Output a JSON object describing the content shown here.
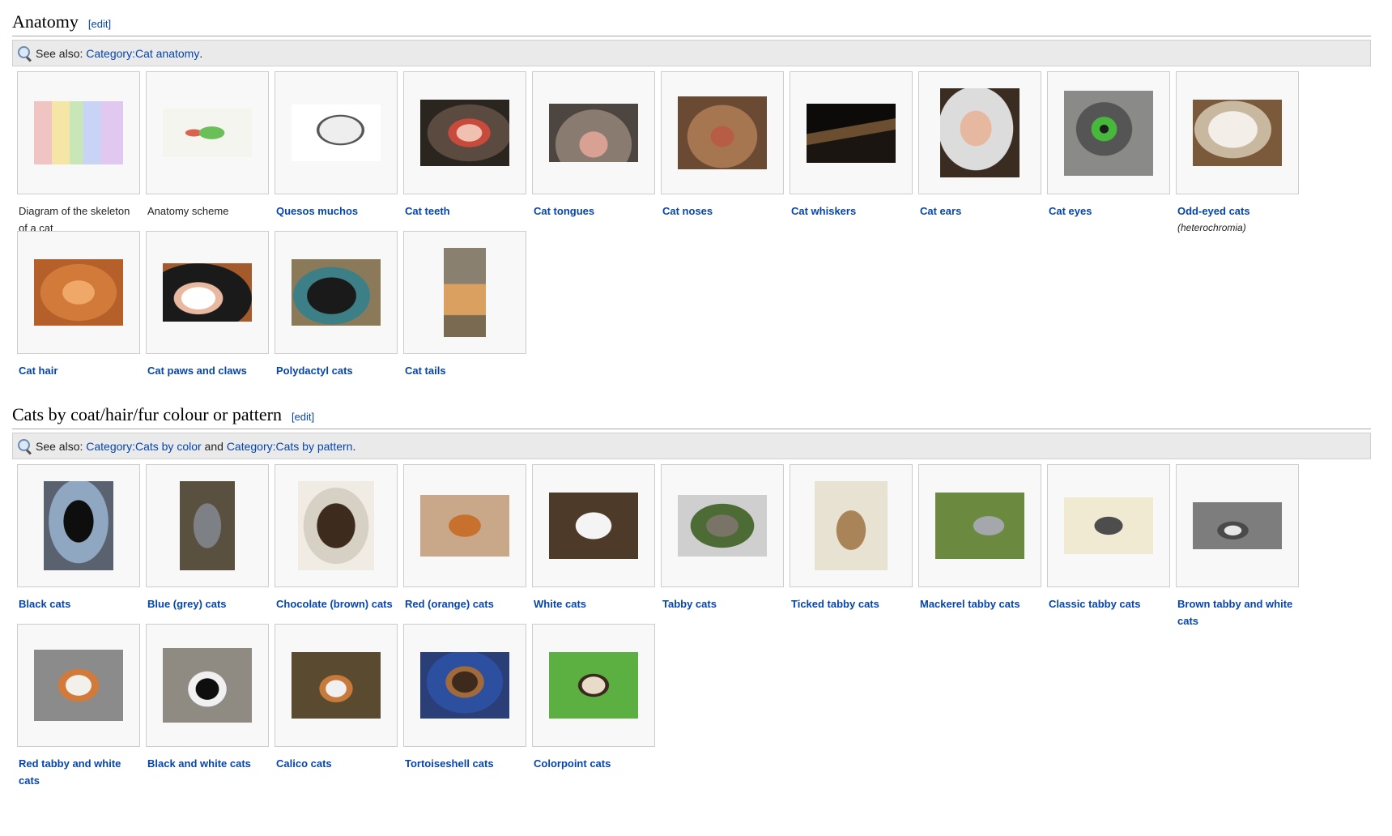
{
  "sections": [
    {
      "title": "Anatomy",
      "edit_label": "[edit]",
      "seealso_prefix": "See also: ",
      "seealso_links": [
        "Category:Cat anatomy"
      ],
      "seealso_suffix": ".",
      "items": [
        {
          "caption": "Diagram of the skeleton of a cat",
          "link": false,
          "icon": "skeleton-diagram-image"
        },
        {
          "caption": "Anatomy scheme",
          "link": false,
          "icon": "anatomy-scheme-image"
        },
        {
          "caption": "Quesos muchos",
          "link": true,
          "icon": "cat-skull-image"
        },
        {
          "caption": "Cat teeth",
          "link": true,
          "icon": "cat-teeth-image"
        },
        {
          "caption": "Cat tongues",
          "link": true,
          "icon": "cat-tongue-image"
        },
        {
          "caption": "Cat noses",
          "link": true,
          "icon": "cat-nose-image"
        },
        {
          "caption": "Cat whiskers",
          "link": true,
          "icon": "cat-whiskers-image"
        },
        {
          "caption": "Cat ears",
          "link": true,
          "icon": "cat-ear-image"
        },
        {
          "caption": "Cat eyes",
          "link": true,
          "icon": "cat-eye-image"
        },
        {
          "caption": "Odd-eyed cats",
          "sub": "(heterochromia)",
          "link": true,
          "icon": "odd-eyed-cat-image"
        },
        {
          "caption": "Cat hair",
          "link": true,
          "icon": "cat-hair-image"
        },
        {
          "caption": "Cat paws and claws",
          "link": true,
          "icon": "cat-paw-image"
        },
        {
          "caption": "Polydactyl cats",
          "link": true,
          "icon": "polydactyl-cat-image"
        },
        {
          "caption": "Cat tails",
          "link": true,
          "icon": "cat-tail-image"
        }
      ]
    },
    {
      "title": "Cats by coat/hair/fur colour or pattern",
      "edit_label": "[edit]",
      "seealso_prefix": "See also: ",
      "seealso_links": [
        "Category:Cats by color",
        "Category:Cats by pattern"
      ],
      "seealso_joiner": " and ",
      "seealso_suffix": ".",
      "items": [
        {
          "caption": "Black cats",
          "link": true,
          "icon": "black-cat-image"
        },
        {
          "caption": "Blue (grey) cats",
          "link": true,
          "icon": "blue-cat-image"
        },
        {
          "caption": "Chocolate (brown) cats",
          "link": true,
          "icon": "chocolate-cat-image"
        },
        {
          "caption": "Red (orange) cats",
          "link": true,
          "icon": "red-cat-image"
        },
        {
          "caption": "White cats",
          "link": true,
          "icon": "white-cat-image"
        },
        {
          "caption": "Tabby cats",
          "link": true,
          "icon": "tabby-cat-image"
        },
        {
          "caption": "Ticked tabby cats",
          "link": true,
          "icon": "ticked-tabby-cat-image"
        },
        {
          "caption": "Mackerel tabby cats",
          "link": true,
          "icon": "mackerel-tabby-cat-image"
        },
        {
          "caption": "Classic tabby cats",
          "link": true,
          "icon": "classic-tabby-cat-image"
        },
        {
          "caption": "Brown tabby and white cats",
          "link": true,
          "icon": "brown-tabby-white-cat-image"
        },
        {
          "caption": "Red tabby and white cats",
          "link": true,
          "icon": "red-tabby-white-cat-image"
        },
        {
          "caption": "Black and white cats",
          "link": true,
          "icon": "black-white-cat-image"
        },
        {
          "caption": "Calico cats",
          "link": true,
          "icon": "calico-cat-image"
        },
        {
          "caption": "Tortoiseshell cats",
          "link": true,
          "icon": "tortoiseshell-cat-image"
        },
        {
          "caption": "Colorpoint cats",
          "link": true,
          "icon": "colorpoint-cat-image"
        }
      ]
    }
  ],
  "colors": {
    "link": "#0645ad",
    "seealso_bg": "#eaeaea",
    "thumb_bg": "#f8f8f8"
  }
}
